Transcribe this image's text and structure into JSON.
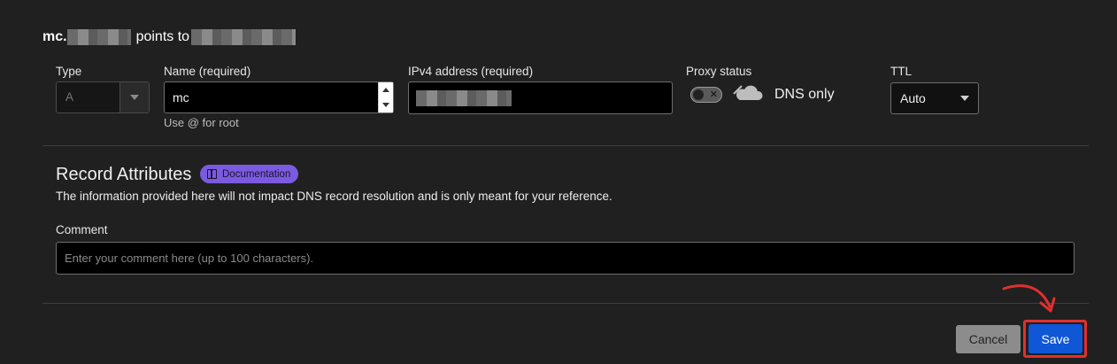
{
  "summary": {
    "record_prefix": "mc.",
    "connector": "points to"
  },
  "fields": {
    "type": {
      "label": "Type",
      "value": "A"
    },
    "name": {
      "label": "Name (required)",
      "value": "mc",
      "hint": "Use @ for root"
    },
    "ipv4": {
      "label": "IPv4 address (required)"
    },
    "proxy": {
      "label": "Proxy status",
      "state_text": "DNS only"
    },
    "ttl": {
      "label": "TTL",
      "value": "Auto"
    }
  },
  "attributes": {
    "title": "Record Attributes",
    "badge": "Documentation",
    "description": "The information provided here will not impact DNS record resolution and is only meant for your reference."
  },
  "comment": {
    "label": "Comment",
    "placeholder": "Enter your comment here (up to 100 characters)."
  },
  "actions": {
    "cancel": "Cancel",
    "save": "Save"
  },
  "colors": {
    "background": "#202020",
    "save_button": "#0f57d6",
    "highlight": "#e03030",
    "badge": "#7a5be0"
  },
  "icons": [
    "cloud-icon",
    "book-icon",
    "chevron-down-icon",
    "arrow-annotation-icon"
  ]
}
